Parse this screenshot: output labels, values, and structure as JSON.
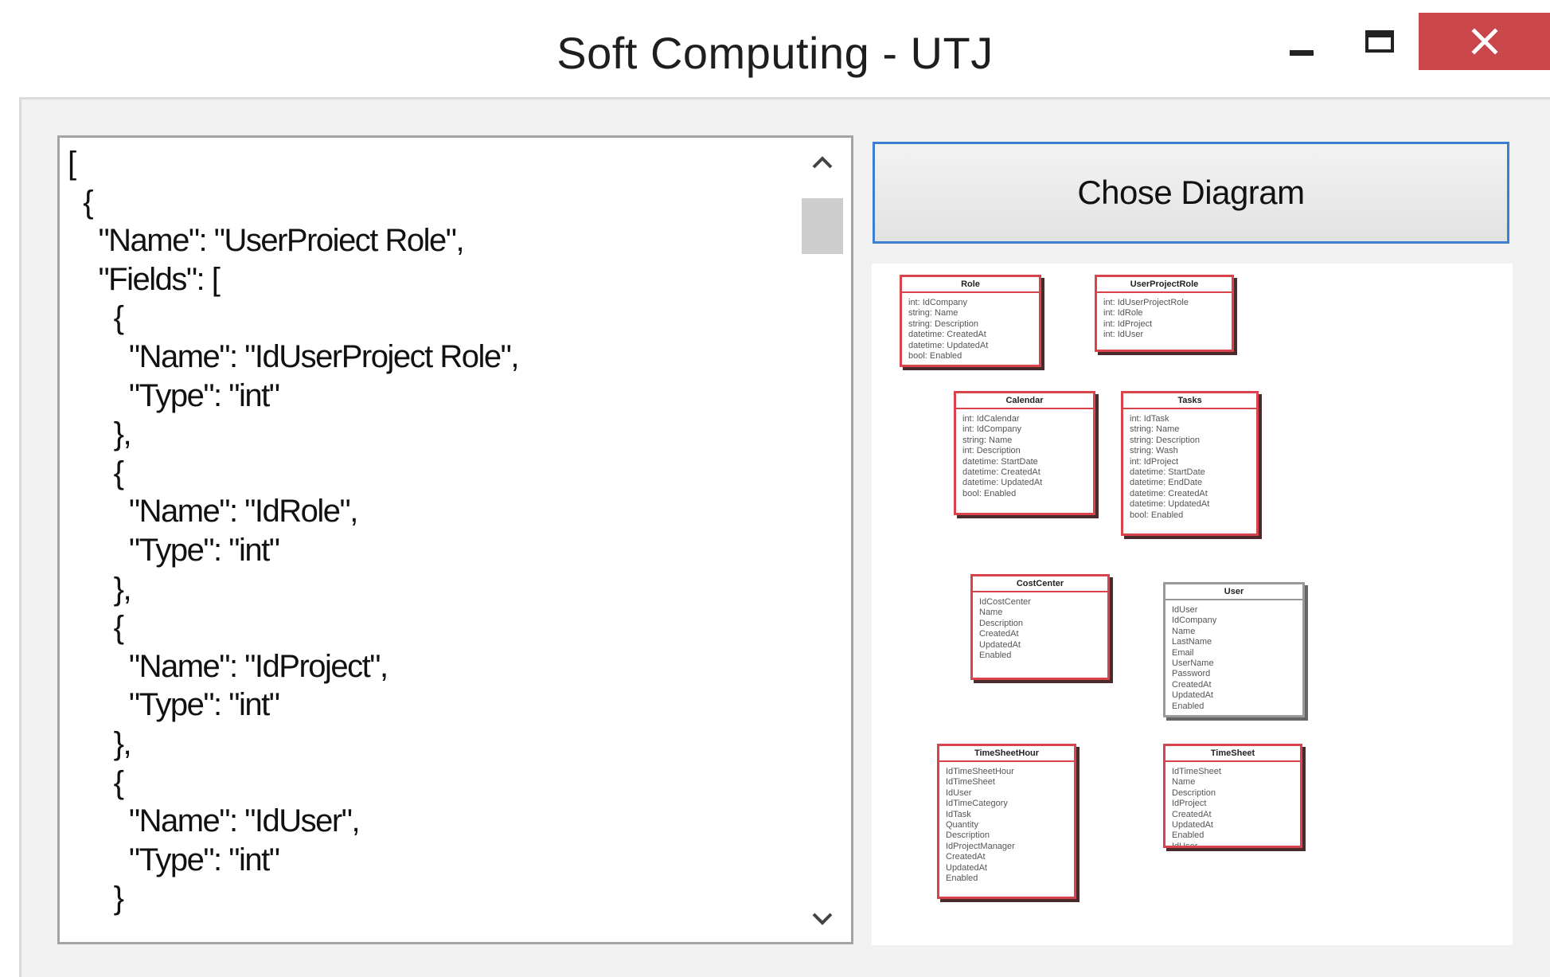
{
  "window": {
    "title": "Soft Computing - UTJ",
    "buttons": {
      "minimize": "minimize-icon",
      "maximize": "maximize-icon",
      "close": "close-icon"
    },
    "colors": {
      "close_bg": "#c9464a",
      "frame_bg": "#f0f1f0",
      "button_border": "#3c7fd1",
      "class_border": "#d8434c"
    }
  },
  "json_editor": {
    "lines": [
      "[",
      "  {",
      "    \"Name\": \"UserProiect Role\",",
      "    \"Fields\": [",
      "      {",
      "        \"Name\": \"IdUserProject Role\",",
      "        \"Type\": \"int\"",
      "      },",
      "      {",
      "        \"Name\": \"IdRole\",",
      "        \"Type\": \"int\"",
      "      },",
      "      {",
      "        \"Name\": \"IdProject\",",
      "        \"Type\": \"int\"",
      "      },",
      "      {",
      "        \"Name\": \"IdUser\",",
      "        \"Type\": \"int\"",
      "      }"
    ],
    "scroll_up_icon": "chevron-up-icon",
    "scroll_down_icon": "chevron-down-icon"
  },
  "chose_button": {
    "label": "Chose Diagram"
  },
  "diagram": {
    "classes": [
      {
        "id": "role",
        "title": "Role",
        "fields": [
          "int: IdCompany",
          "string: Name",
          "string: Description",
          "datetime: CreatedAt",
          "datetime: UpdatedAt",
          "bool: Enabled"
        ]
      },
      {
        "id": "userprojectrole",
        "title": "UserProjectRole",
        "fields": [
          "int: IdUserProjectRole",
          "int: IdRole",
          "int: IdProject",
          "int: IdUser"
        ]
      },
      {
        "id": "calendar",
        "title": "Calendar",
        "fields": [
          "int: IdCalendar",
          "int: IdCompany",
          "string: Name",
          "int: Description",
          "datetime: StartDate",
          "datetime: CreatedAt",
          "datetime: UpdatedAt",
          "bool: Enabled"
        ]
      },
      {
        "id": "tasks",
        "title": "Tasks",
        "fields": [
          "int: IdTask",
          "string: Name",
          "string: Description",
          "string: Wash",
          "int: IdProject",
          "datetime: StartDate",
          "datetime: EndDate",
          "datetime: CreatedAt",
          "datetime: UpdatedAt",
          "bool: Enabled"
        ]
      },
      {
        "id": "costcenter",
        "title": "CostCenter",
        "fields": [
          "IdCostCenter",
          "Name",
          "Description",
          "CreatedAt",
          "UpdatedAt",
          "Enabled"
        ]
      },
      {
        "id": "user",
        "title": "User",
        "fields": [
          "IdUser",
          "IdCompany",
          "Name",
          "LastName",
          "Email",
          "UserName",
          "Password",
          "CreatedAt",
          "UpdatedAt",
          "Enabled"
        ]
      },
      {
        "id": "timesheethour",
        "title": "TimeSheetHour",
        "fields": [
          "IdTimeSheetHour",
          "IdTimeSheet",
          "IdUser",
          "IdTimeCategory",
          "IdTask",
          "Quantity",
          "Description",
          "IdProjectManager",
          "CreatedAt",
          "UpdatedAt",
          "Enabled"
        ]
      },
      {
        "id": "timesheet",
        "title": "TimeSheet",
        "fields": [
          "IdTimeSheet",
          "Name",
          "Description",
          "IdProject",
          "CreatedAt",
          "UpdatedAt",
          "Enabled",
          "IdUser"
        ]
      }
    ]
  }
}
